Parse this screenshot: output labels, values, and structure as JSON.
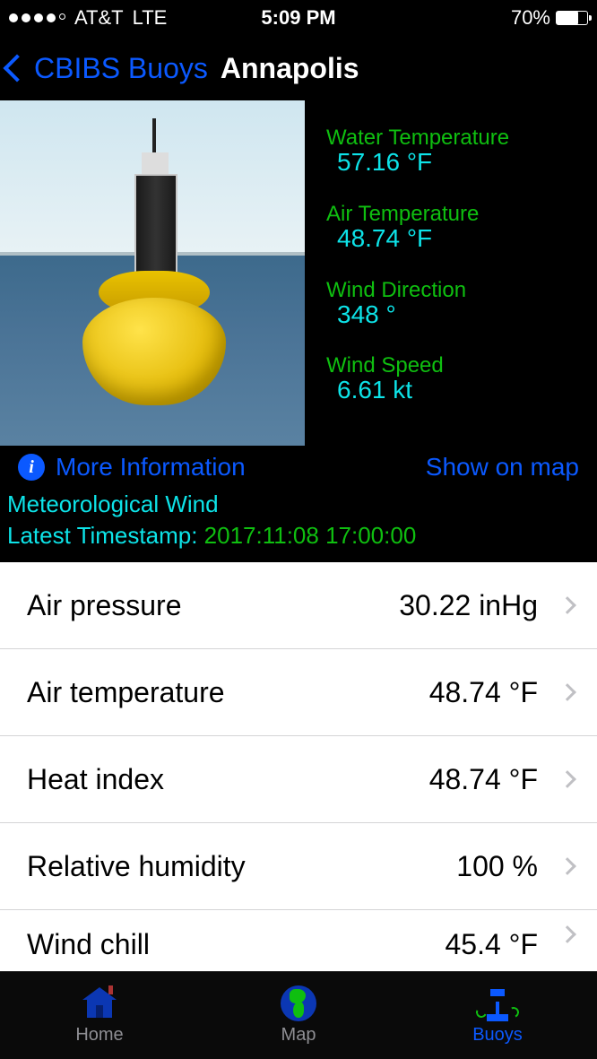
{
  "status": {
    "carrier": "AT&T",
    "network": "LTE",
    "time": "5:09 PM",
    "battery_pct": "70%"
  },
  "nav": {
    "back_label": "CBIBS Buoys",
    "title": "Annapolis"
  },
  "summary": {
    "items": [
      {
        "label": "Water Temperature",
        "value": "57.16 °F"
      },
      {
        "label": "Air Temperature",
        "value": "48.74 °F"
      },
      {
        "label": "Wind Direction",
        "value": "348 °"
      },
      {
        "label": "Wind Speed",
        "value": "6.61 kt"
      }
    ]
  },
  "links": {
    "more_info": "More Information",
    "show_on_map": "Show on map"
  },
  "section_title": "Meteorological Wind",
  "timestamp_label": "Latest Timestamp:",
  "timestamp_value": "2017:11:08 17:00:00",
  "list": [
    {
      "label": "Air pressure",
      "value": "30.22 inHg"
    },
    {
      "label": "Air temperature",
      "value": "48.74 °F"
    },
    {
      "label": "Heat index",
      "value": "48.74 °F"
    },
    {
      "label": "Relative humidity",
      "value": "100 %"
    },
    {
      "label": "Wind chill",
      "value": "45.4 °F"
    }
  ],
  "tabs": {
    "home": "Home",
    "map": "Map",
    "buoys": "Buoys"
  }
}
